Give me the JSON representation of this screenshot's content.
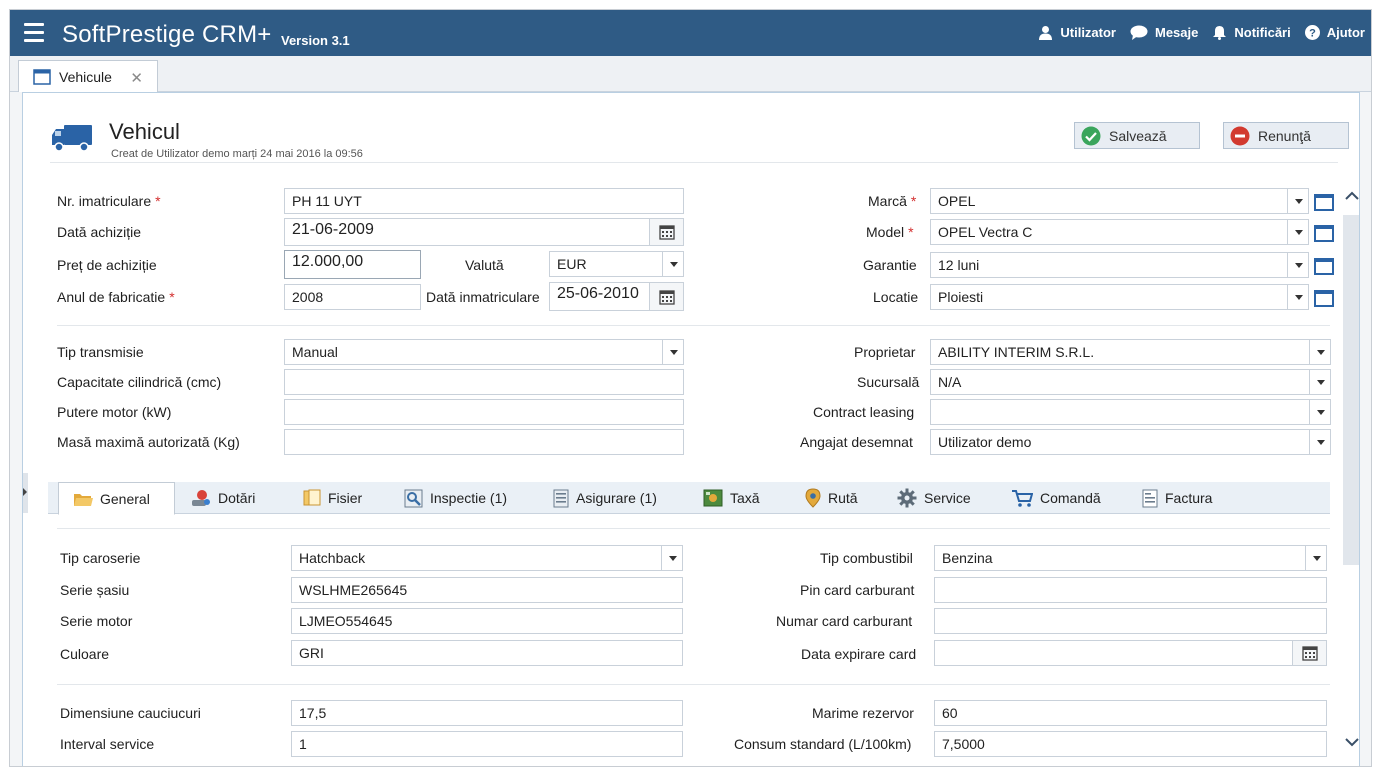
{
  "app": {
    "brand": "SoftPrestige CRM+",
    "version": "Version 3.1"
  },
  "topnav": [
    {
      "label": "Utilizator",
      "icon": "user-icon"
    },
    {
      "label": "Mesaje",
      "icon": "chat-bubble-icon"
    },
    {
      "label": "Notificări",
      "icon": "bell-icon"
    },
    {
      "label": "Ajutor",
      "icon": "help-icon"
    }
  ],
  "doc_tab": {
    "label": "Vehicule"
  },
  "page": {
    "title": "Vehicul",
    "subtitle": "Creat de Utilizator demo marți 24 mai 2016 la 09:56",
    "save_label": "Salvează",
    "cancel_label": "Renunţă"
  },
  "form_top_left": {
    "nr_label": "Nr. imatriculare",
    "nr_value": "PH 11 UYT",
    "data_achizitie_label": "Dată achiziție",
    "data_achizitie_value": "21-06-2009",
    "pret_label": "Preț de achiziție",
    "pret_value": "12.000,00",
    "valuta_label": "Valută",
    "valuta_value": "EUR",
    "an_label": "Anul de fabricatie",
    "an_value": "2008",
    "data_inm_label": "Dată inmatriculare",
    "data_inm_value": "25-06-2010"
  },
  "form_top_right": {
    "marca_label": "Marcă",
    "marca_value": "OPEL",
    "model_label": "Model",
    "model_value": "OPEL Vectra C",
    "garantie_label": "Garantie",
    "garantie_value": "12 luni",
    "locatie_label": "Locatie",
    "locatie_value": "Ploiesti"
  },
  "form_mid_left": {
    "transmisie_label": "Tip transmisie",
    "transmisie_value": "Manual",
    "capacitate_label": "Capacitate cilindrică (cmc)",
    "capacitate_value": "",
    "putere_label": "Putere motor (kW)",
    "putere_value": "",
    "masa_label": "Masă maximă autorizată (Kg)",
    "masa_value": ""
  },
  "form_mid_right": {
    "proprietar_label": "Proprietar",
    "proprietar_value": "ABILITY INTERIM S.R.L.",
    "sucursala_label": "Sucursală",
    "sucursala_value": "N/A",
    "leasing_label": "Contract leasing",
    "leasing_value": "",
    "angajat_label": "Angajat desemnat",
    "angajat_value": "Utilizator demo"
  },
  "tabs": [
    {
      "label": "General",
      "icon": "folder-icon"
    },
    {
      "label": "Dotări",
      "icon": "equipment-icon"
    },
    {
      "label": "Fisier",
      "icon": "files-icon"
    },
    {
      "label": "Inspectie (1)",
      "icon": "inspection-icon"
    },
    {
      "label": "Asigurare (1)",
      "icon": "document-list-icon"
    },
    {
      "label": "Taxă",
      "icon": "tax-icon"
    },
    {
      "label": "Rută",
      "icon": "map-pin-icon"
    },
    {
      "label": "Service",
      "icon": "gear-icon"
    },
    {
      "label": "Comandă",
      "icon": "cart-icon"
    },
    {
      "label": "Factura",
      "icon": "invoice-icon"
    }
  ],
  "general_left": {
    "caroserie_label": "Tip caroserie",
    "caroserie_value": "Hatchback",
    "sasiu_label": "Serie șasiu",
    "sasiu_value": "WSLHME265645",
    "motor_label": "Serie motor",
    "motor_value": "LJMEO554645",
    "culoare_label": "Culoare",
    "culoare_value": "GRI",
    "cauciucuri_label": "Dimensiune cauciucuri",
    "cauciucuri_value": "17,5",
    "interval_label": "Interval service",
    "interval_value": "1"
  },
  "general_right": {
    "combustibil_label": "Tip combustibil",
    "combustibil_value": "Benzina",
    "pin_label": "Pin card carburant",
    "pin_value": "",
    "numar_card_label": "Numar card carburant",
    "numar_card_value": "",
    "expirare_label": "Data expirare card",
    "expirare_value": "",
    "rezervor_label": "Marime rezervor",
    "rezervor_value": "60",
    "consum_label": "Consum standard (L/100km)",
    "consum_value": "7,5000"
  },
  "colors": {
    "topbar": "#2f5b85",
    "accent": "#2a63a6",
    "required": "#d32f2f"
  }
}
